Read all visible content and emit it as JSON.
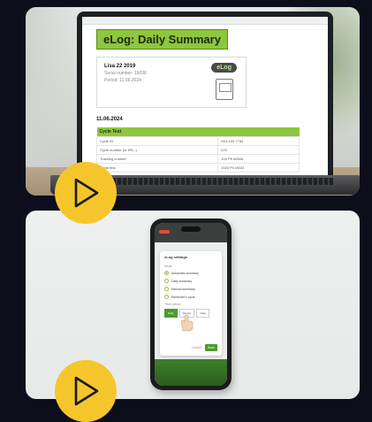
{
  "laptop_doc": {
    "title": "eLog: Daily Summary",
    "logo_text": "eLog",
    "lines": [
      "Lisa 22 2019",
      "Serial number: 19036",
      "Period: 11.06.2024"
    ],
    "date": "11.06.2024",
    "table_header": "Cycle Test",
    "table_rows": [
      [
        "Cycle ID",
        "H44 105 7784"
      ],
      [
        "Cycle number (of IPA...)",
        "670"
      ],
      [
        "Tracking number",
        "103 P5 #0006"
      ],
      [
        "Cycle test",
        "2023 P4 M023"
      ]
    ]
  },
  "phone_app": {
    "dialog_title": "eLog settings",
    "section_label": "Mode",
    "options": [
      "Automatic summary",
      "Daily summary",
      "Manual summary",
      "Reminder's cycle"
    ],
    "segment_label": "Time period",
    "segments": [
      "Daily",
      "Weekly",
      "Daily"
    ],
    "cancel_label": "Cancel",
    "ok_label": "Save"
  },
  "colors": {
    "background": "#0d0e1c",
    "accent_yellow": "#f5c62c",
    "brand_green": "#8dc63f"
  }
}
